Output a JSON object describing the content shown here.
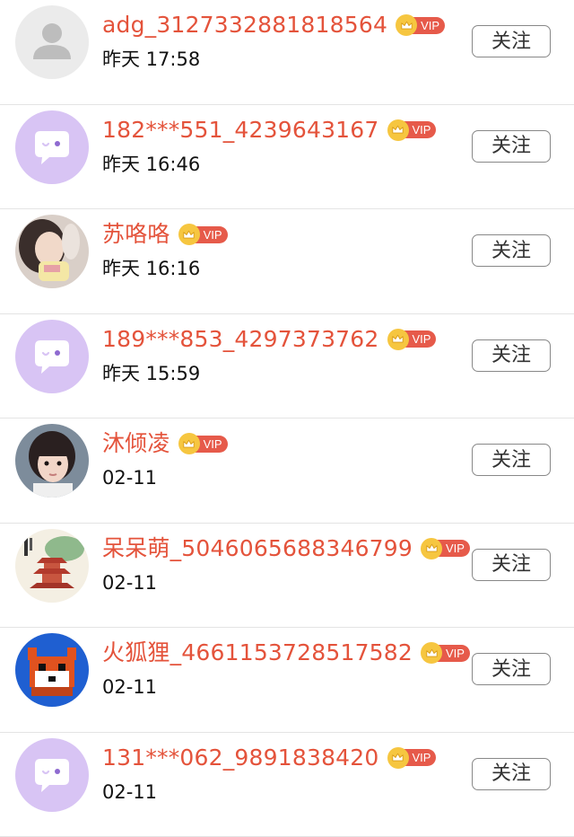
{
  "follow_label": "关注",
  "vip_label": "VIP",
  "colors": {
    "name": "#e4533b",
    "vip_tag": "#e65a4a",
    "vip_crown": "#f6c640",
    "chat_avatar_bg": "#d8c4f4"
  },
  "users": [
    {
      "name": "adg_3127332881818564",
      "time": "昨天 17:58",
      "avatar": "default-person-avatar",
      "vip": true
    },
    {
      "name": "182***551_4239643167",
      "time": "昨天 16:46",
      "avatar": "chat-bubble-avatar",
      "vip": true
    },
    {
      "name": "苏咯咯",
      "time": "昨天 16:16",
      "avatar": "photo-avatar-girl",
      "vip": true
    },
    {
      "name": "189***853_4297373762",
      "time": "昨天 15:59",
      "avatar": "chat-bubble-avatar",
      "vip": true
    },
    {
      "name": "沐倾凌",
      "time": "02-11",
      "avatar": "photo-avatar-child",
      "vip": true
    },
    {
      "name": "呆呆萌_5046065688346799",
      "time": "02-11",
      "avatar": "pagoda-painting-avatar",
      "vip": true
    },
    {
      "name": "火狐狸_4661153728517582",
      "time": "02-11",
      "avatar": "pixel-fox-avatar",
      "vip": true
    },
    {
      "name": "131***062_9891838420",
      "time": "02-11",
      "avatar": "chat-bubble-avatar",
      "vip": true
    }
  ]
}
